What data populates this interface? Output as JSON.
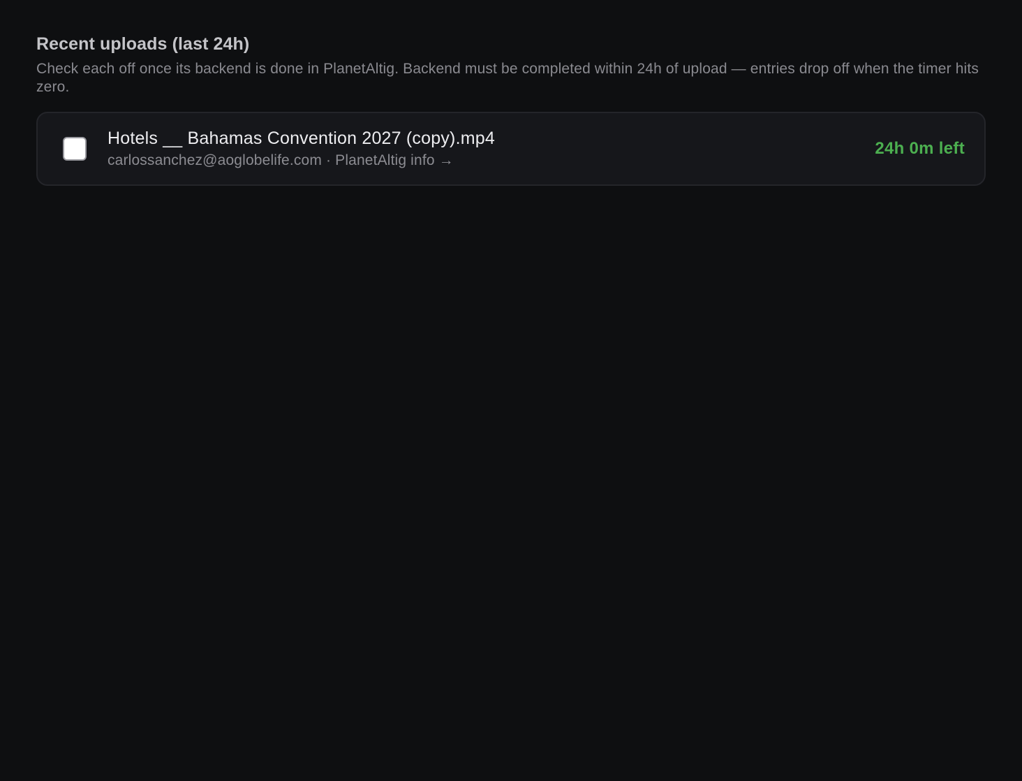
{
  "section": {
    "title": "Recent uploads (last 24h)",
    "subtitle": "Check each off once its backend is done in PlanetAltig. Backend must be completed within 24h of upload — entries drop off when the timer hits zero."
  },
  "uploads": [
    {
      "file_name": "Hotels __ Bahamas Convention 2027 (copy).mp4",
      "uploader_email": "carlossanchez@aoglobelife.com",
      "separator": "·",
      "info_link_label": "PlanetAltig info →",
      "time_left": "24h 0m left",
      "checked": false
    }
  ],
  "colors": {
    "background": "#0e0f11",
    "card_background": "#16171b",
    "card_border": "#24252a",
    "time_left": "#4caf50"
  }
}
